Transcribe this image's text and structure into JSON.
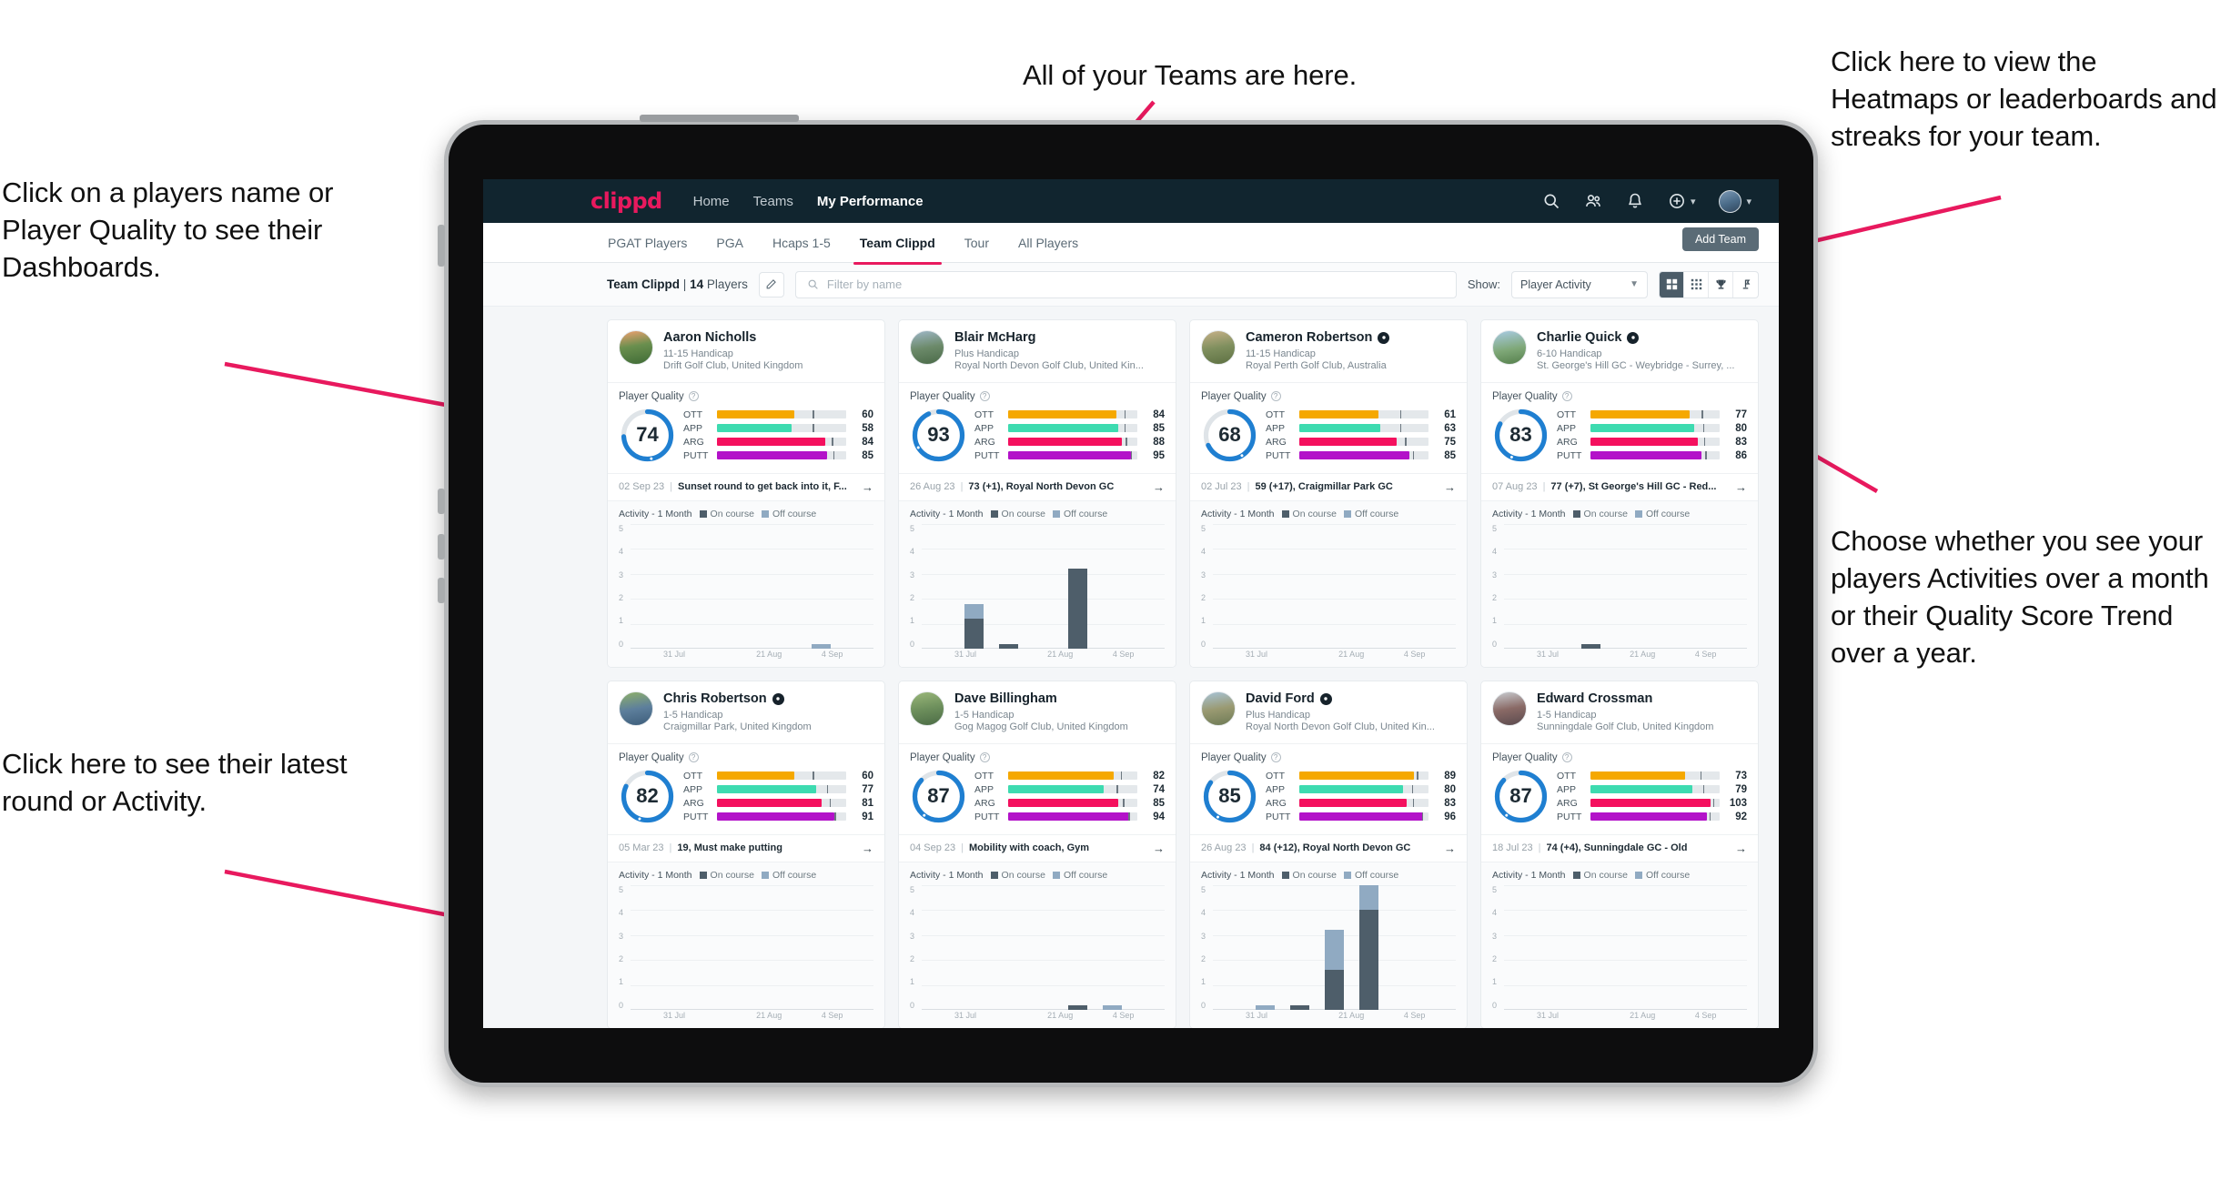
{
  "annotations": {
    "top": "All of your Teams are here.",
    "left_top": "Click on a players name or Player Quality to see their Dashboards.",
    "left_bottom": "Click here to see their latest round or Activity.",
    "right_top": "Click here to view the Heatmaps or leaderboards and streaks for your team.",
    "right_bottom": "Choose whether you see your players Activities over a month or their Quality Score Trend over a year.",
    "arrow_color": "#e8195e"
  },
  "app": {
    "brand": "clippd",
    "nav": [
      {
        "label": "Home",
        "active": false
      },
      {
        "label": "Teams",
        "active": false
      },
      {
        "label": "My Performance",
        "active": true
      }
    ],
    "icons": [
      "search-icon",
      "people-icon",
      "bell-icon",
      "plus-circle-icon",
      "avatar"
    ],
    "tabs": [
      {
        "label": "PGAT Players",
        "active": false
      },
      {
        "label": "PGA",
        "active": false
      },
      {
        "label": "Hcaps 1-5",
        "active": false
      },
      {
        "label": "Team Clippd",
        "active": true
      },
      {
        "label": "Tour",
        "active": false
      },
      {
        "label": "All Players",
        "active": false
      }
    ],
    "add_team_label": "Add Team",
    "filter": {
      "team_name": "Team Clippd",
      "separator": "|",
      "player_count": "14",
      "players_word": "Players",
      "search_placeholder": "Filter by name",
      "show_label": "Show:",
      "show_value": "Player Activity",
      "view_toggles": [
        {
          "name": "grid-view-icon",
          "active": true
        },
        {
          "name": "dots-grid-view-icon",
          "active": false
        },
        {
          "name": "trophy-view-icon",
          "active": false
        },
        {
          "name": "flag-view-icon",
          "active": false
        }
      ]
    },
    "card_labels": {
      "player_quality": "Player Quality",
      "activity": "Activity - 1 Month",
      "legend_on": "On course",
      "legend_off": "Off course",
      "y_ticks": [
        "5",
        "4",
        "3",
        "2",
        "1",
        "0"
      ],
      "x_ticks": [
        "31 Jul",
        "21 Aug",
        "4 Sep"
      ]
    },
    "colors": {
      "brand": "#e8195e",
      "header_bg": "#11252f",
      "ott": "#f5a800",
      "app": "#3ddbb0",
      "arg": "#f4105e",
      "putt": "#b312c9",
      "ring": "#1f7fd1",
      "on_course": "#4e5e6a",
      "off_course": "#90aac2"
    }
  },
  "players": [
    {
      "name": "Aaron Nicholls",
      "verified": false,
      "handicap": "11-15 Handicap",
      "club": "Drift Golf Club, United Kingdom",
      "quality": 74,
      "metrics": [
        {
          "label": "OTT",
          "value": 60,
          "pct": 60,
          "tick": 74
        },
        {
          "label": "APP",
          "value": 58,
          "pct": 58,
          "tick": 74
        },
        {
          "label": "ARG",
          "value": 84,
          "pct": 84,
          "tick": 89
        },
        {
          "label": "PUTT",
          "value": 85,
          "pct": 85,
          "tick": 90
        }
      ],
      "round_date": "02 Sep 23",
      "round_text": "Sunset round to get back into it, F...",
      "activity": [
        {
          "on": 0,
          "off": 0
        },
        {
          "on": 0,
          "off": 0
        },
        {
          "on": 0,
          "off": 0
        },
        {
          "on": 0,
          "off": 0
        },
        {
          "on": 0,
          "off": 0
        },
        {
          "on": 0,
          "off": 1
        },
        {
          "on": 0,
          "off": 0
        }
      ]
    },
    {
      "name": "Blair McHarg",
      "verified": false,
      "handicap": "Plus Handicap",
      "club": "Royal North Devon Golf Club, United Kin...",
      "quality": 93,
      "metrics": [
        {
          "label": "OTT",
          "value": 84,
          "pct": 84,
          "tick": 90
        },
        {
          "label": "APP",
          "value": 85,
          "pct": 85,
          "tick": 90
        },
        {
          "label": "ARG",
          "value": 88,
          "pct": 88,
          "tick": 91
        },
        {
          "label": "PUTT",
          "value": 95,
          "pct": 95,
          "tick": 95
        }
      ],
      "round_date": "26 Aug 23",
      "round_text": "73 (+1), Royal North Devon GC",
      "activity": [
        {
          "on": 0,
          "off": 0
        },
        {
          "on": 2,
          "off": 1
        },
        {
          "on": 1,
          "off": 0
        },
        {
          "on": 0,
          "off": 0
        },
        {
          "on": 4,
          "off": 0
        },
        {
          "on": 0,
          "off": 0
        },
        {
          "on": 0,
          "off": 0
        }
      ]
    },
    {
      "name": "Cameron Robertson",
      "verified": true,
      "handicap": "11-15 Handicap",
      "club": "Royal Perth Golf Club, Australia",
      "quality": 68,
      "metrics": [
        {
          "label": "OTT",
          "value": 61,
          "pct": 61,
          "tick": 78
        },
        {
          "label": "APP",
          "value": 63,
          "pct": 63,
          "tick": 78
        },
        {
          "label": "ARG",
          "value": 75,
          "pct": 75,
          "tick": 82
        },
        {
          "label": "PUTT",
          "value": 85,
          "pct": 85,
          "tick": 88
        }
      ],
      "round_date": "02 Jul 23",
      "round_text": "59 (+17), Craigmillar Park GC",
      "activity": [
        {
          "on": 0,
          "off": 0
        },
        {
          "on": 0,
          "off": 0
        },
        {
          "on": 0,
          "off": 0
        },
        {
          "on": 0,
          "off": 0
        },
        {
          "on": 0,
          "off": 0
        },
        {
          "on": 0,
          "off": 0
        },
        {
          "on": 0,
          "off": 0
        }
      ]
    },
    {
      "name": "Charlie Quick",
      "verified": true,
      "handicap": "6-10 Handicap",
      "club": "St. George's Hill GC - Weybridge - Surrey, ...",
      "quality": 83,
      "metrics": [
        {
          "label": "OTT",
          "value": 77,
          "pct": 77,
          "tick": 86
        },
        {
          "label": "APP",
          "value": 80,
          "pct": 80,
          "tick": 87
        },
        {
          "label": "ARG",
          "value": 83,
          "pct": 83,
          "tick": 88
        },
        {
          "label": "PUTT",
          "value": 86,
          "pct": 86,
          "tick": 89
        }
      ],
      "round_date": "07 Aug 23",
      "round_text": "77 (+7), St George's Hill GC - Red...",
      "activity": [
        {
          "on": 0,
          "off": 0
        },
        {
          "on": 0,
          "off": 0
        },
        {
          "on": 1,
          "off": 0
        },
        {
          "on": 0,
          "off": 0
        },
        {
          "on": 0,
          "off": 0
        },
        {
          "on": 0,
          "off": 0
        },
        {
          "on": 0,
          "off": 0
        }
      ]
    },
    {
      "name": "Chris Robertson",
      "verified": true,
      "handicap": "1-5 Handicap",
      "club": "Craigmillar Park, United Kingdom",
      "quality": 82,
      "metrics": [
        {
          "label": "OTT",
          "value": 60,
          "pct": 60,
          "tick": 74
        },
        {
          "label": "APP",
          "value": 77,
          "pct": 77,
          "tick": 85
        },
        {
          "label": "ARG",
          "value": 81,
          "pct": 81,
          "tick": 87
        },
        {
          "label": "PUTT",
          "value": 91,
          "pct": 91,
          "tick": 91
        }
      ],
      "round_date": "05 Mar 23",
      "round_text": "19, Must make putting",
      "activity": [
        {
          "on": 0,
          "off": 0
        },
        {
          "on": 0,
          "off": 0
        },
        {
          "on": 0,
          "off": 0
        },
        {
          "on": 0,
          "off": 0
        },
        {
          "on": 0,
          "off": 0
        },
        {
          "on": 0,
          "off": 0
        },
        {
          "on": 0,
          "off": 0
        }
      ]
    },
    {
      "name": "Dave Billingham",
      "verified": false,
      "handicap": "1-5 Handicap",
      "club": "Gog Magog Golf Club, United Kingdom",
      "quality": 87,
      "metrics": [
        {
          "label": "OTT",
          "value": 82,
          "pct": 82,
          "tick": 87
        },
        {
          "label": "APP",
          "value": 74,
          "pct": 74,
          "tick": 84
        },
        {
          "label": "ARG",
          "value": 85,
          "pct": 85,
          "tick": 89
        },
        {
          "label": "PUTT",
          "value": 94,
          "pct": 94,
          "tick": 93
        }
      ],
      "round_date": "04 Sep 23",
      "round_text": "Mobility with coach, Gym",
      "activity": [
        {
          "on": 0,
          "off": 0
        },
        {
          "on": 0,
          "off": 0
        },
        {
          "on": 0,
          "off": 0
        },
        {
          "on": 0,
          "off": 0
        },
        {
          "on": 1,
          "off": 0
        },
        {
          "on": 0,
          "off": 1
        },
        {
          "on": 0,
          "off": 0
        }
      ]
    },
    {
      "name": "David Ford",
      "verified": true,
      "handicap": "Plus Handicap",
      "club": "Royal North Devon Golf Club, United Kin...",
      "quality": 85,
      "metrics": [
        {
          "label": "OTT",
          "value": 89,
          "pct": 89,
          "tick": 91
        },
        {
          "label": "APP",
          "value": 80,
          "pct": 80,
          "tick": 87
        },
        {
          "label": "ARG",
          "value": 83,
          "pct": 83,
          "tick": 88
        },
        {
          "label": "PUTT",
          "value": 96,
          "pct": 96,
          "tick": 95
        }
      ],
      "round_date": "26 Aug 23",
      "round_text": "84 (+12), Royal North Devon GC",
      "activity": [
        {
          "on": 0,
          "off": 0
        },
        {
          "on": 0,
          "off": 1
        },
        {
          "on": 1,
          "off": 0
        },
        {
          "on": 2,
          "off": 2
        },
        {
          "on": 4,
          "off": 1
        },
        {
          "on": 0,
          "off": 0
        },
        {
          "on": 0,
          "off": 0
        }
      ]
    },
    {
      "name": "Edward Crossman",
      "verified": false,
      "handicap": "1-5 Handicap",
      "club": "Sunningdale Golf Club, United Kingdom",
      "quality": 87,
      "metrics": [
        {
          "label": "OTT",
          "value": 73,
          "pct": 73,
          "tick": 85
        },
        {
          "label": "APP",
          "value": 79,
          "pct": 79,
          "tick": 87
        },
        {
          "label": "ARG",
          "value": 103,
          "pct": 93,
          "tick": 95
        },
        {
          "label": "PUTT",
          "value": 92,
          "pct": 90,
          "tick": 92
        }
      ],
      "round_date": "18 Jul 23",
      "round_text": "74 (+4), Sunningdale GC - Old",
      "activity": [
        {
          "on": 0,
          "off": 0
        },
        {
          "on": 0,
          "off": 0
        },
        {
          "on": 0,
          "off": 0
        },
        {
          "on": 0,
          "off": 0
        },
        {
          "on": 0,
          "off": 0
        },
        {
          "on": 0,
          "off": 0
        },
        {
          "on": 0,
          "off": 0
        }
      ]
    }
  ]
}
